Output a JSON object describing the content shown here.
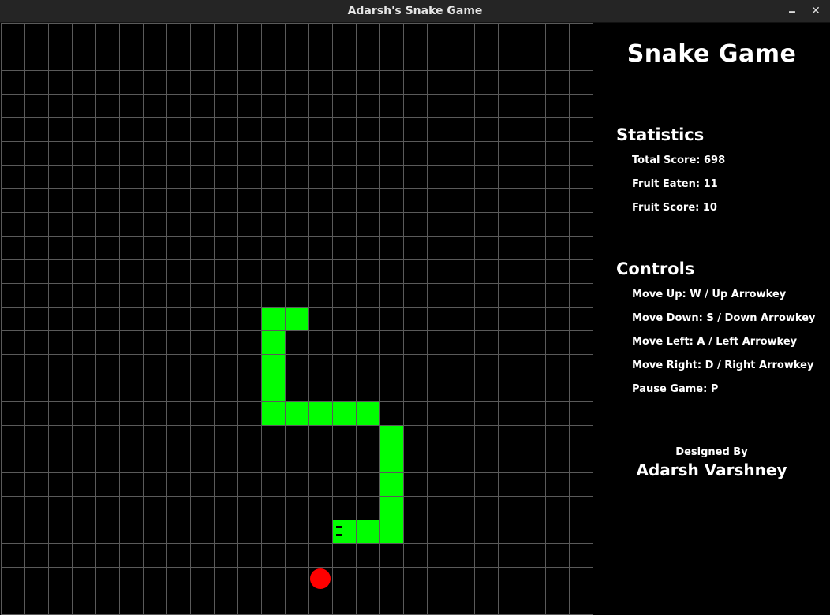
{
  "window": {
    "title": "Adarsh's Snake Game",
    "minimize_label": "🗕",
    "close_label": "✕"
  },
  "board": {
    "grid_columns": 25,
    "grid_rows": 25,
    "snake_color": "#00ff00",
    "fruit_color": "#ff0000",
    "grid_color": "#5a5a5a",
    "snake_cells": [
      [
        14,
        21
      ],
      [
        15,
        21
      ],
      [
        16,
        21
      ],
      [
        16,
        20
      ],
      [
        16,
        19
      ],
      [
        16,
        18
      ],
      [
        16,
        17
      ],
      [
        15,
        16
      ],
      [
        14,
        16
      ],
      [
        13,
        16
      ],
      [
        12,
        16
      ],
      [
        11,
        16
      ],
      [
        11,
        15
      ],
      [
        11,
        14
      ],
      [
        11,
        13
      ],
      [
        11,
        12
      ],
      [
        12,
        12
      ]
    ],
    "snake_head_cell": [
      14,
      21
    ],
    "snake_head_facing": "left",
    "fruit_cell": [
      13,
      23
    ]
  },
  "sidebar": {
    "game_title": "Snake Game",
    "statistics_heading": "Statistics",
    "stats": [
      "Total Score: 698",
      "Fruit Eaten: 11",
      "Fruit Score: 10"
    ],
    "controls_heading": "Controls",
    "controls": [
      "Move Up: W / Up Arrowkey",
      "Move Down: S / Down Arrowkey",
      "Move Left: A / Left Arrowkey",
      "Move Right: D / Right Arrowkey",
      "Pause Game: P"
    ],
    "designed_by_label": "Designed By",
    "author": "Adarsh Varshney"
  }
}
